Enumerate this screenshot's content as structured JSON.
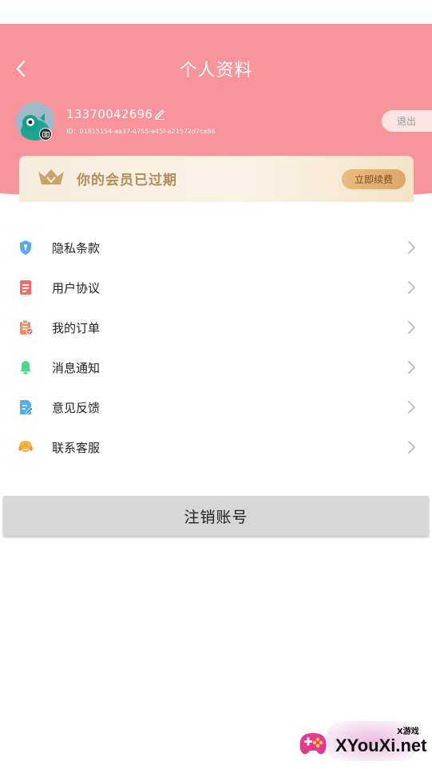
{
  "header": {
    "title": "个人资料",
    "back_icon": "chevron-left-icon",
    "background_color": "#f7949b"
  },
  "profile": {
    "phone": "13370042696",
    "id_text": "ID：01815154-aa37-4755-a45f-a21572d7ce86",
    "logout_label": "退出",
    "avatar_icon": "avatar-icon",
    "camera_icon": "camera-icon",
    "edit_icon": "pencil-icon"
  },
  "membership": {
    "status_text": "你的会员已过期",
    "renew_label": "立即续费",
    "icon": "crown-icon"
  },
  "menu": {
    "items": [
      {
        "label": "隐私条款",
        "icon": "shield-icon",
        "color": "#5aa9f0"
      },
      {
        "label": "用户协议",
        "icon": "document-icon",
        "color": "#f26b6b"
      },
      {
        "label": "我的订单",
        "icon": "clipboard-icon",
        "color": "#f28a5c"
      },
      {
        "label": "消息通知",
        "icon": "bell-icon",
        "color": "#4cd68f"
      },
      {
        "label": "意见反馈",
        "icon": "feedback-icon",
        "color": "#4fb2ef"
      },
      {
        "label": "联系客服",
        "icon": "headset-icon",
        "color": "#f5b13d"
      }
    ]
  },
  "actions": {
    "delete_account_label": "注销账号"
  },
  "watermark": {
    "small_text": "X游戏",
    "site_text": "XYouXi.net"
  }
}
